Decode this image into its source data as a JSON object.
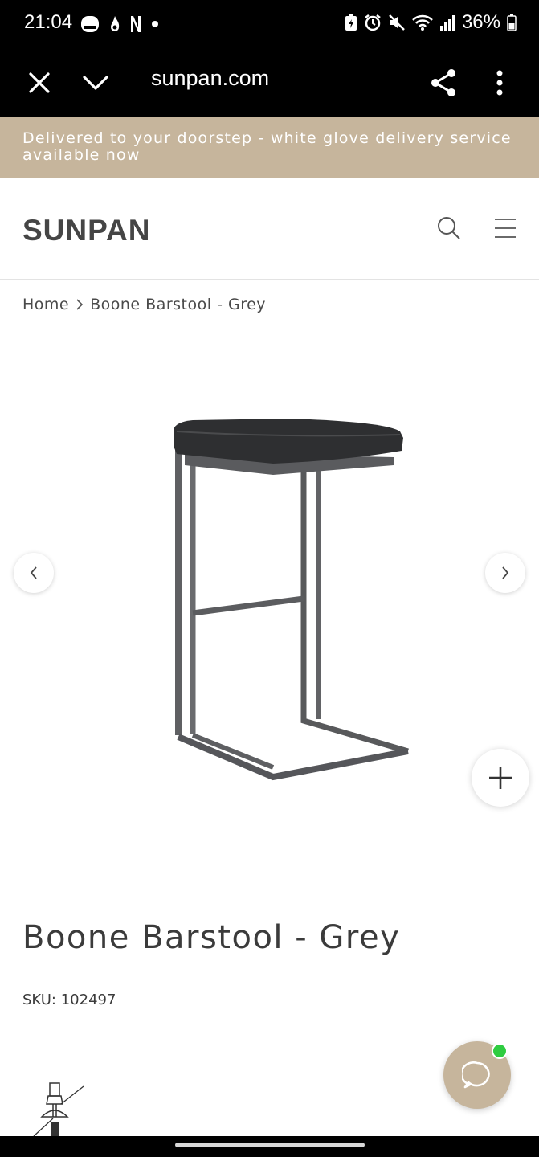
{
  "status_bar": {
    "time": "21:04",
    "battery": "36%"
  },
  "browser": {
    "url": "sunpan.com"
  },
  "promo": {
    "text": "Delivered to your doorstep - white glove delivery service available now"
  },
  "header": {
    "logo": "SUNPAN"
  },
  "breadcrumb": {
    "home": "Home",
    "current": "Boone Barstool - Grey"
  },
  "product": {
    "title": "Boone Barstool - Grey",
    "sku": "SKU: 102497"
  },
  "colors": {
    "promo_bg": "#c6b59c",
    "chat_bg": "#c6b59c",
    "online_dot": "#2ecc40"
  }
}
